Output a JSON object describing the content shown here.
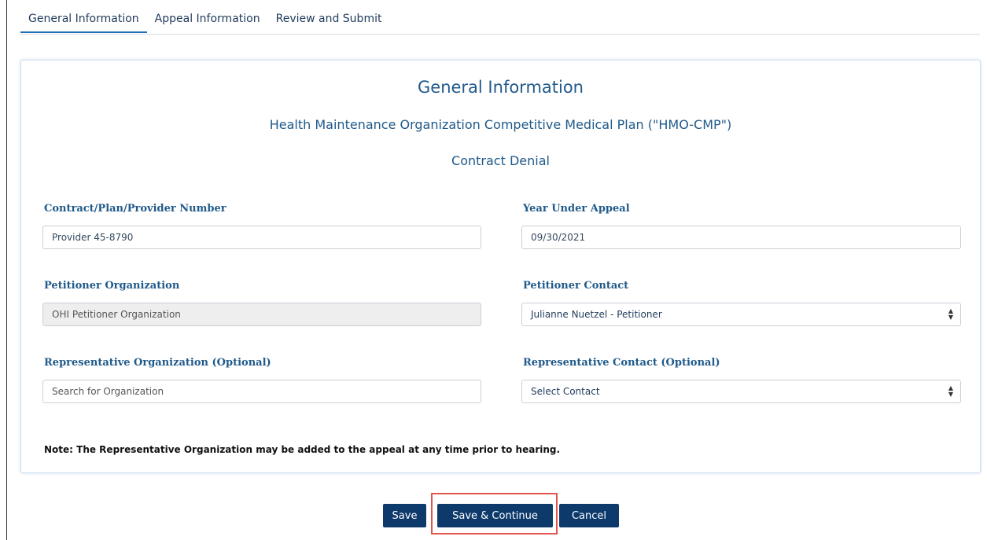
{
  "tabs": [
    {
      "label": "General Information",
      "active": true
    },
    {
      "label": "Appeal Information",
      "active": false
    },
    {
      "label": "Review and Submit",
      "active": false
    }
  ],
  "card": {
    "title": "General Information",
    "subtitle": "Health Maintenance Organization Competitive Medical Plan (\"HMO-CMP\")",
    "subtitle2": "Contract Denial"
  },
  "fields": {
    "contract_number": {
      "label": "Contract/Plan/Provider Number",
      "value": "Provider 45-8790"
    },
    "year_under_appeal": {
      "label": "Year Under Appeal",
      "value": "09/30/2021"
    },
    "petitioner_org": {
      "label": "Petitioner Organization",
      "value": "OHI Petitioner Organization",
      "disabled": true
    },
    "petitioner_contact": {
      "label": "Petitioner Contact",
      "value": "Julianne Nuetzel - Petitioner"
    },
    "rep_org": {
      "label": "Representative Organization (Optional)",
      "placeholder": "Search for Organization"
    },
    "rep_contact": {
      "label": "Representative Contact (Optional)",
      "value": "Select Contact"
    }
  },
  "note": "Note: The Representative Organization may be added to the appeal at any time prior to hearing.",
  "buttons": {
    "save": "Save",
    "save_continue": "Save & Continue",
    "cancel": "Cancel"
  },
  "colors": {
    "accent": "#1e6fb6",
    "heading": "#205a8a",
    "button": "#0e3a6b",
    "highlight": "#e0554f"
  }
}
